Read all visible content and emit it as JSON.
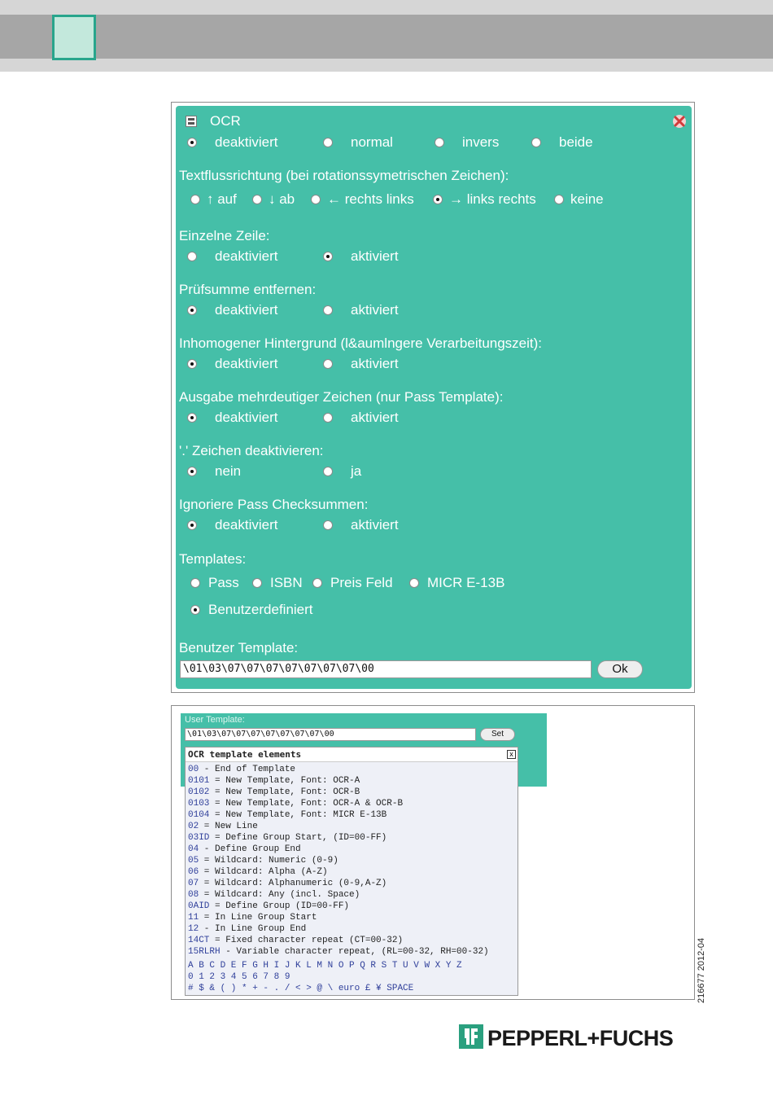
{
  "ocr_panel": {
    "title": "OCR",
    "mode_options": [
      "deaktiviert",
      "normal",
      "invers",
      "beide"
    ],
    "mode_selected": 0,
    "text_direction": {
      "label": "Textflussrichtung (bei rotationssymetrischen Zeichen):",
      "options": [
        "↑ auf",
        "↓ ab",
        "← rechts links",
        "→ links rechts",
        "keine"
      ],
      "selected": 3
    },
    "groups": [
      {
        "label": "Einzelne Zeile:",
        "options": [
          "deaktiviert",
          "aktiviert"
        ],
        "selected": 1
      },
      {
        "label": "Prüfsumme entfernen:",
        "options": [
          "deaktiviert",
          "aktiviert"
        ],
        "selected": 0
      },
      {
        "label": "Inhomogener Hintergrund (l&aumlngere Verarbeitungszeit):",
        "options": [
          "deaktiviert",
          "aktiviert"
        ],
        "selected": 0
      },
      {
        "label": "Ausgabe mehrdeutiger Zeichen (nur Pass Template):",
        "options": [
          "deaktiviert",
          "aktiviert"
        ],
        "selected": 0
      },
      {
        "label": "'.' Zeichen deaktivieren:",
        "options": [
          "nein",
          "ja"
        ],
        "selected": 0
      },
      {
        "label": "Ignoriere Pass Checksummen:",
        "options": [
          "deaktiviert",
          "aktiviert"
        ],
        "selected": 0
      }
    ],
    "templates": {
      "label": "Templates:",
      "options": [
        "Pass",
        "ISBN",
        "Preis Feld",
        "MICR E-13B",
        "Benutzerdefiniert"
      ],
      "selected": 4
    },
    "user_template": {
      "label": "Benutzer Template:",
      "value": "\\01\\03\\07\\07\\07\\07\\07\\07\\07\\00",
      "ok_label": "Ok"
    },
    "accent_color": "#45bfa8"
  },
  "template_panel": {
    "label": "User Template:",
    "value": "\\01\\03\\07\\07\\07\\07\\07\\07\\07\\00",
    "set_label": "Set",
    "popup_title": "OCR template elements",
    "close_glyph": "x",
    "elements": [
      {
        "code": "00",
        "desc": " - End of Template"
      },
      {
        "code": "0101",
        "desc": " = New Template, Font: OCR-A"
      },
      {
        "code": "0102",
        "desc": " = New Template, Font: OCR-B"
      },
      {
        "code": "0103",
        "desc": " = New Template, Font: OCR-A & OCR-B"
      },
      {
        "code": "0104",
        "desc": " = New Template, Font: MICR E-13B"
      },
      {
        "code": "02",
        "desc": " = New Line"
      },
      {
        "code": "03ID",
        "desc": " = Define Group Start, (ID=00-FF)"
      },
      {
        "code": "04",
        "desc": " - Define Group End"
      },
      {
        "code": "05",
        "desc": " = Wildcard: Numeric (0-9)"
      },
      {
        "code": "06",
        "desc": " = Wildcard: Alpha (A-Z)"
      },
      {
        "code": "07",
        "desc": " = Wildcard: Alphanumeric (0-9,A-Z)"
      },
      {
        "code": "08",
        "desc": " = Wildcard: Any (incl. Space)"
      },
      {
        "code": "0AID",
        "desc": " = Define Group (ID=00-FF)"
      },
      {
        "code": "11",
        "desc": " = In Line Group Start"
      },
      {
        "code": "12",
        "desc": " - In Line Group End"
      },
      {
        "code": "14CT",
        "desc": " = Fixed character repeat (CT=00-32)"
      },
      {
        "code": "15RLRH",
        "desc": " - Variable character repeat, (RL=00-32, RH=00-32)"
      }
    ],
    "letters": "A B C D E F G H I J K L M N O P Q R S T U V W X Y Z",
    "digits": "0 1 2 3 4 5 6 7 8 9",
    "symbols": "# $ & ( ) * + - . / < > @ \\ euro £ ¥ SPACE"
  },
  "doc_code": "216677 2012-04",
  "brand": "PEPPERL+FUCHS"
}
